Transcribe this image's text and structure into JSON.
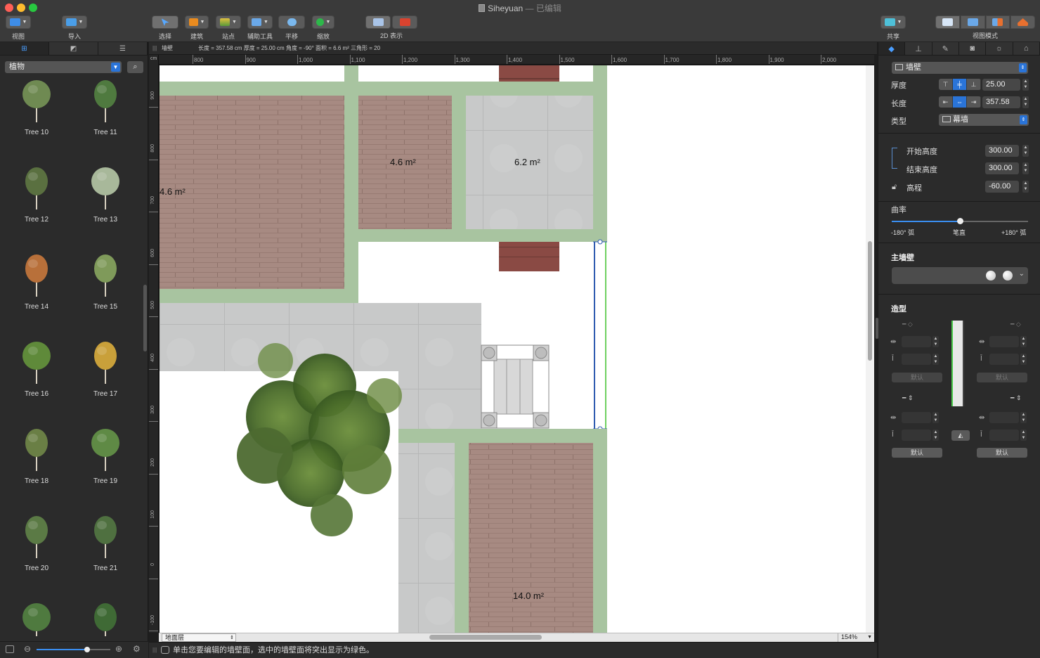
{
  "window": {
    "title": "Siheyuan",
    "subtitle": "— 已编辑"
  },
  "toolbar": {
    "view": "视图",
    "import": "导入",
    "select": "选择",
    "build": "建筑",
    "site": "站点",
    "guides": "辅助工具",
    "pan": "平移",
    "zoom": "缩放",
    "display2d": "2D 表示",
    "share": "共享",
    "view_mode": "视图模式"
  },
  "library": {
    "category": "植物",
    "items": [
      {
        "label": "Tree 10",
        "color": "#6f8a52"
      },
      {
        "label": "Tree 11",
        "color": "#4f7a3f"
      },
      {
        "label": "Tree 12",
        "color": "#5a7040"
      },
      {
        "label": "Tree 13",
        "color": "#a8b89a"
      },
      {
        "label": "Tree 14",
        "color": "#b8703a"
      },
      {
        "label": "Tree 15",
        "color": "#7f9a5a"
      },
      {
        "label": "Tree 16",
        "color": "#5f8a3a"
      },
      {
        "label": "Tree 17",
        "color": "#c9a03a"
      },
      {
        "label": "Tree 18",
        "color": "#6a7f45"
      },
      {
        "label": "Tree 19",
        "color": "#5f8a45"
      },
      {
        "label": "Tree 20",
        "color": "#5b7a45"
      },
      {
        "label": "Tree 21",
        "color": "#4f7040"
      },
      {
        "label": "",
        "color": "#4f7a3f"
      },
      {
        "label": "",
        "color": "#3f6a35"
      }
    ]
  },
  "infobar": {
    "item": "墙壁",
    "details": "长度 = 357.58 cm    厚度 = 25.00 cm    角度 = -90°    面积 = 6.6 m²    三角形 = 20"
  },
  "rulers": {
    "unit": "cm",
    "h_ticks": [
      "800",
      "900",
      "1,000",
      "1,100",
      "1,200",
      "1,300",
      "1,400",
      "1,500",
      "1,600",
      "1,700",
      "1,800",
      "1,900",
      "2,000"
    ],
    "v_ticks": [
      "900",
      "800",
      "700",
      "600",
      "500",
      "400",
      "300",
      "200",
      "100",
      "0",
      "-100"
    ]
  },
  "plan": {
    "rooms": [
      {
        "area": "4.6 m²"
      },
      {
        "area": "4.6 m²"
      },
      {
        "area": "6.2 m²"
      },
      {
        "area": "14.0 m²"
      }
    ]
  },
  "canvas_footer": {
    "layer": "地面层",
    "zoom": "154%"
  },
  "status": {
    "message": "单击您要编辑的墙壁面，选中的墙壁面将突出显示为绿色。"
  },
  "inspector": {
    "object_type": "墙壁",
    "thickness_label": "厚度",
    "thickness": "25.00",
    "length_label": "长度",
    "length": "357.58",
    "type_label": "类型",
    "type_value": "幕墙",
    "start_height_label": "开始高度",
    "start_height": "300.00",
    "end_height_label": "结束高度",
    "end_height": "300.00",
    "elevation_label": "高程",
    "elevation": "-60.00",
    "curvature_label": "曲率",
    "curvature_min": "-180° 弧",
    "curvature_mid": "笔直",
    "curvature_max": "+180° 弧",
    "curvature_value": 0.5,
    "main_wall_label": "主墙壁",
    "profile_label": "造型",
    "default_label": "默认"
  }
}
